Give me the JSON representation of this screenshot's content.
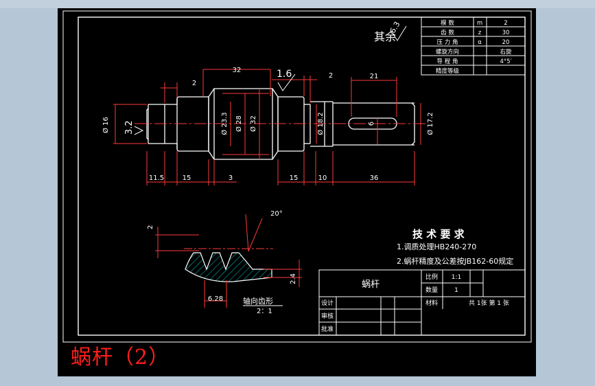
{
  "caption": "蜗杆（2）",
  "params_table": {
    "rows": [
      {
        "name": "模 数",
        "symbol": "m",
        "value": "2"
      },
      {
        "name": "齿 数",
        "symbol": "z",
        "value": "30"
      },
      {
        "name": "压 力 角",
        "symbol": "α",
        "value": "20"
      },
      {
        "name": "螺旋方向",
        "symbol": "",
        "value": "右旋"
      },
      {
        "name": "导 程 角",
        "symbol": "",
        "value": "4°5′"
      },
      {
        "name": "精度等级",
        "symbol": "",
        "value": ""
      }
    ]
  },
  "roughness_other": "其余",
  "roughness_other_value": "6.3",
  "roughness_values": [
    "1.6",
    "3.2"
  ],
  "dimensions": {
    "top": [
      "32",
      "2",
      "2",
      "21"
    ],
    "diameters": [
      "Ø 16",
      "Ø 23.3",
      "Ø 28",
      "Ø 32",
      "Ø 18.2",
      "6",
      "Ø 17.2"
    ],
    "bottom": [
      "11.5",
      "15",
      "3",
      "15",
      "10",
      "36"
    ]
  },
  "tooth_detail": {
    "angle": "20°",
    "height": "2",
    "pitch": "6.28",
    "depth": "2.4",
    "label": "轴向齿形",
    "scale": "2：1"
  },
  "tech_req": {
    "title": "技 术 要 求",
    "items": [
      "1.调质处理HB240-270",
      "2.蜗杆精度及公差按JB162-60规定"
    ]
  },
  "title_block": {
    "part_name": "蜗杆",
    "scale_label": "比例",
    "scale_value": "1:1",
    "qty_label": "数量",
    "qty_value": "1",
    "material_label": "材料",
    "sheets": "共 1张  第 1 张",
    "designer_label": "设计",
    "reviewer_label": "审核",
    "approver_label": "批准"
  },
  "colors": {
    "line": "#ffffff",
    "dimension": "#ff3a3a",
    "hatch": "#00c8c8",
    "caption": "#ff1d1d",
    "sheet": "#000000"
  }
}
